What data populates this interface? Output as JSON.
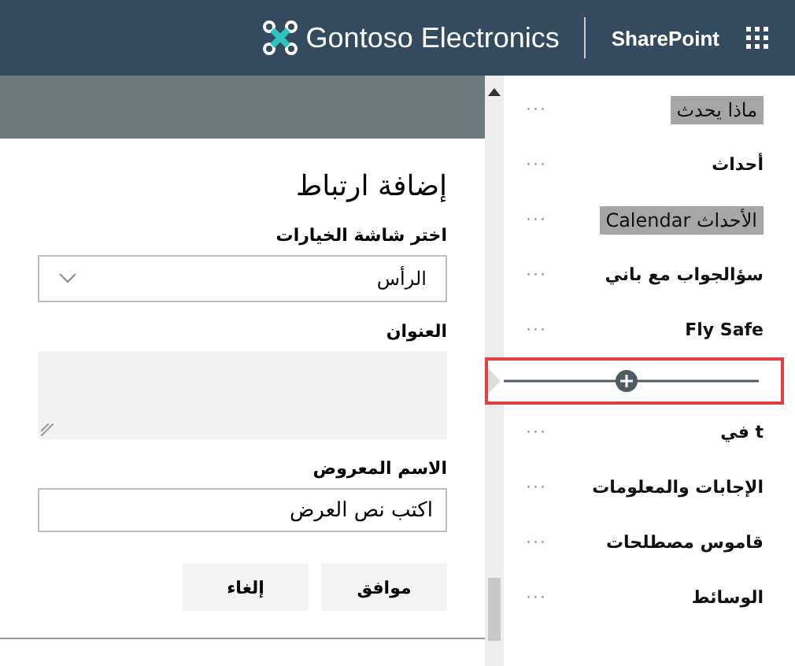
{
  "top_bar": {
    "site_name": "Gontoso Electronics",
    "product": "SharePoint"
  },
  "panel": {
    "title": "إضافة ارتباط",
    "choose_label": "اختر شاشة الخيارات",
    "choose_value": "الرأس",
    "address_label": "العنوان",
    "display_label": "الاسم المعروض",
    "display_value": "اكتب نص العرض",
    "buttons": [
      "موافق",
      "إلغاء"
    ]
  },
  "nav": {
    "items": [
      {
        "kind": "link",
        "label": "ماذا يحدث",
        "highlighted": true,
        "more": "···"
      },
      {
        "kind": "link",
        "label": "أحداث",
        "highlighted": false,
        "more": "···"
      },
      {
        "kind": "link",
        "label": "Calendar الأحداث",
        "highlighted": true,
        "more": "···"
      },
      {
        "kind": "link",
        "label": "سؤالجواب مع باني",
        "highlighted": false,
        "more": "···"
      },
      {
        "kind": "link",
        "label": "Fly Safe",
        "highlighted": false,
        "more": "···"
      },
      {
        "kind": "add_link"
      },
      {
        "kind": "link",
        "label": "في t",
        "highlighted": false,
        "more": "···"
      },
      {
        "kind": "link",
        "label": "الإجابات والمعلومات",
        "highlighted": false,
        "more": "···"
      },
      {
        "kind": "link",
        "label": "قاموس مصطلحات",
        "highlighted": false,
        "more": "···"
      },
      {
        "kind": "link",
        "label": "الوسائط",
        "highlighted": false,
        "more": "···"
      }
    ]
  }
}
